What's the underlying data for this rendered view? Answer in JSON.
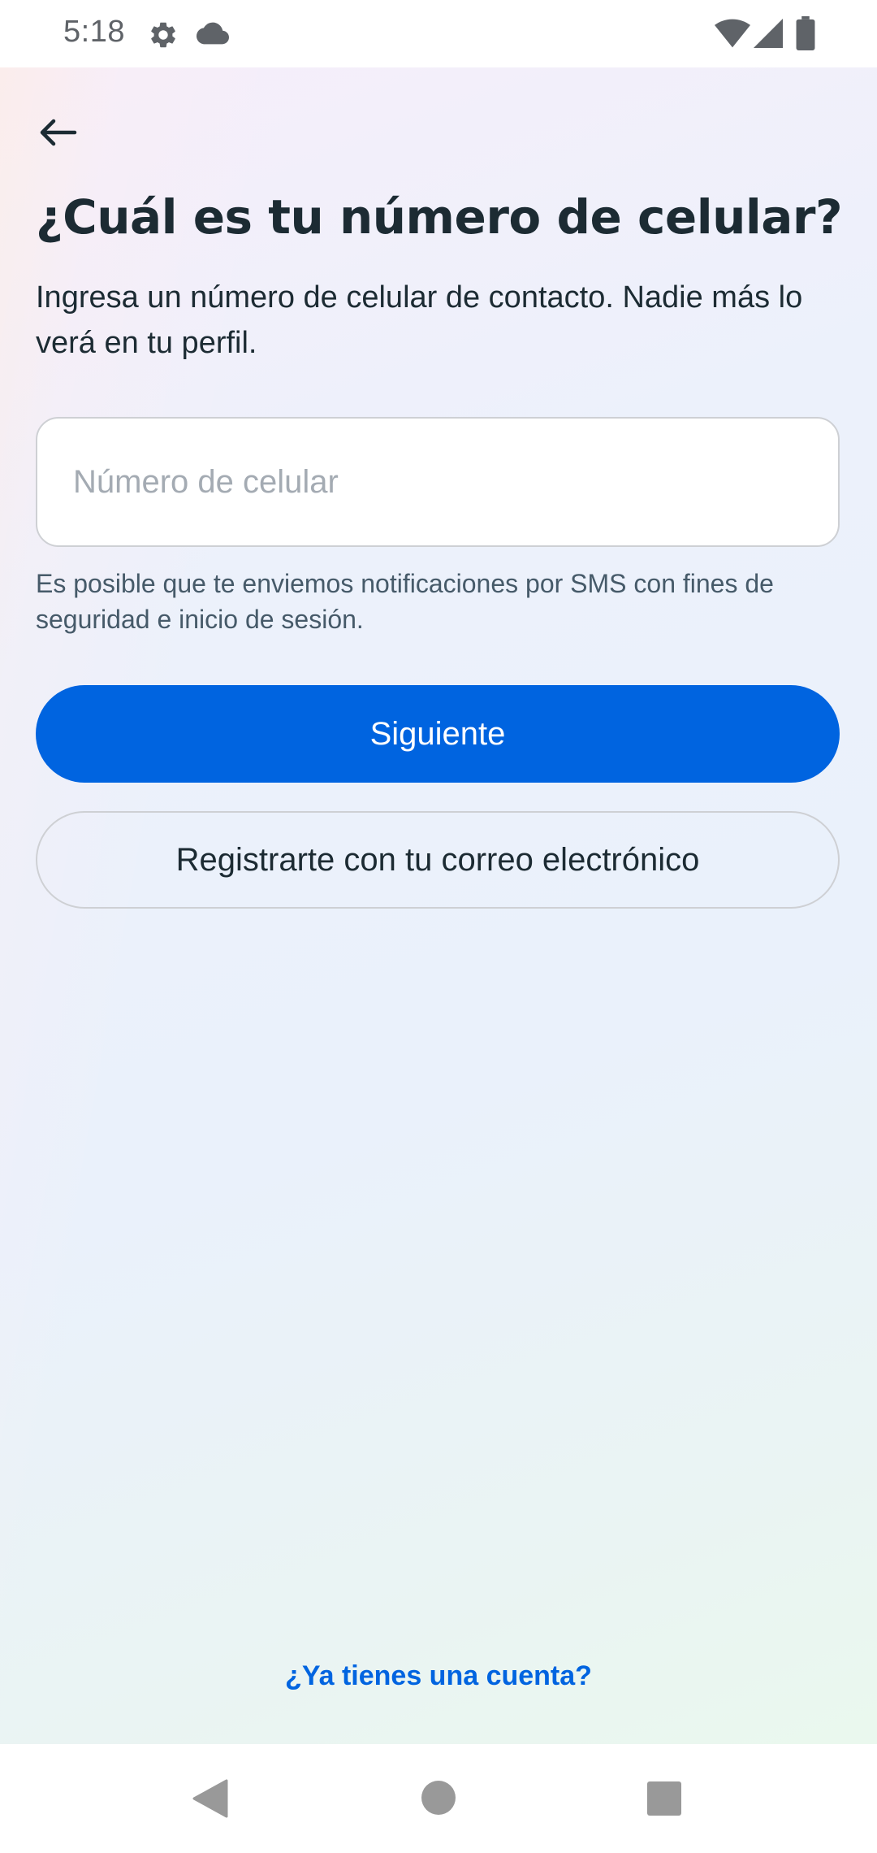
{
  "status_bar": {
    "time": "5:18",
    "icons": [
      "gear-icon",
      "cloud-icon",
      "wifi-icon",
      "cell-signal-icon",
      "battery-icon"
    ]
  },
  "header": {
    "back_icon": "arrow-left-icon",
    "title": "¿Cuál es tu número de celular?",
    "subtitle": "Ingresa un número de celular de contacto. Nadie más lo verá en tu perfil."
  },
  "form": {
    "phone": {
      "value": "",
      "placeholder": "Número de celular"
    },
    "sms_note": "Es posible que te enviemos notificaciones por SMS con fines de seguridad e inicio de sesión.",
    "next_label": "Siguiente",
    "email_signup_label": "Registrarte con tu correo electrónico"
  },
  "footer": {
    "login_link": "¿Ya tienes una cuenta?"
  },
  "nav_bar": {
    "icons": [
      "nav-back-icon",
      "nav-home-icon",
      "nav-recents-icon"
    ]
  },
  "colors": {
    "primary": "#0064e0",
    "text": "#1c2b33",
    "secondary_text": "#465a69",
    "border": "#ced0d4",
    "placeholder": "#a4abb3"
  }
}
